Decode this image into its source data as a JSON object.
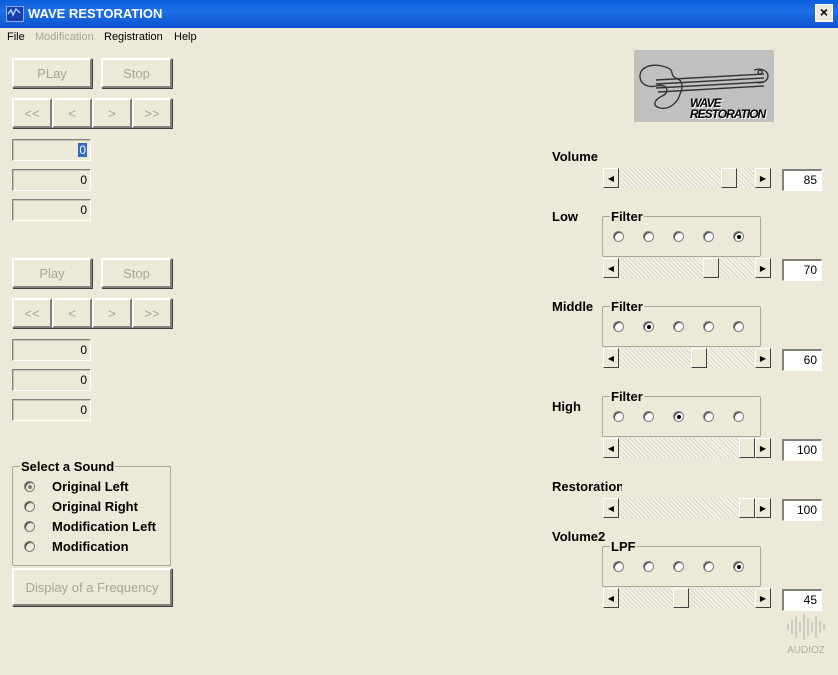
{
  "window": {
    "title": "WAVE RESTORATION",
    "close_label": "×"
  },
  "menu": [
    {
      "label": "File",
      "enabled": true
    },
    {
      "label": "Modification",
      "enabled": false
    },
    {
      "label": "Registration",
      "enabled": true
    },
    {
      "label": "Help",
      "enabled": true
    }
  ],
  "player1": {
    "play_label": "PLay",
    "stop_label": "Stop",
    "nav": [
      "<<",
      "<",
      ">",
      ">>"
    ],
    "fields": [
      "0",
      "0",
      "0"
    ]
  },
  "player2": {
    "play_label": "Play",
    "stop_label": "Stop",
    "nav": [
      "<<",
      "<",
      ">",
      ">>"
    ],
    "fields": [
      "0",
      "0",
      "0"
    ]
  },
  "select_sound": {
    "legend": "Select a Sound",
    "options": [
      "Original Left",
      "Original Right",
      "Modification Left",
      "Modification"
    ],
    "selected_index": 0
  },
  "frequency_button": "Display of a Frequency",
  "logo": {
    "line1": "WAVE",
    "line2": "RESTORATION"
  },
  "controls": {
    "volume": {
      "label": "Volume",
      "value": "85",
      "level": 0.85
    },
    "low": {
      "label": "Low",
      "filter_legend": "Filter",
      "selected": 4,
      "value": "70",
      "level": 0.7
    },
    "middle": {
      "label": "Middle",
      "filter_legend": "Filter",
      "selected": 1,
      "value": "60",
      "level": 0.6
    },
    "high": {
      "label": "High",
      "filter_legend": "Filter",
      "selected": 2,
      "value": "100",
      "level": 1.0
    },
    "restoration": {
      "label": "Restoration",
      "value": "100",
      "level": 1.0
    },
    "volume2": {
      "label": "Volume2",
      "filter_legend": "LPF",
      "selected": 4,
      "value": "45",
      "level": 0.45
    }
  },
  "watermark": "AUDIOZ",
  "icons": {
    "scroll_left": "◀",
    "scroll_right": "▶"
  }
}
